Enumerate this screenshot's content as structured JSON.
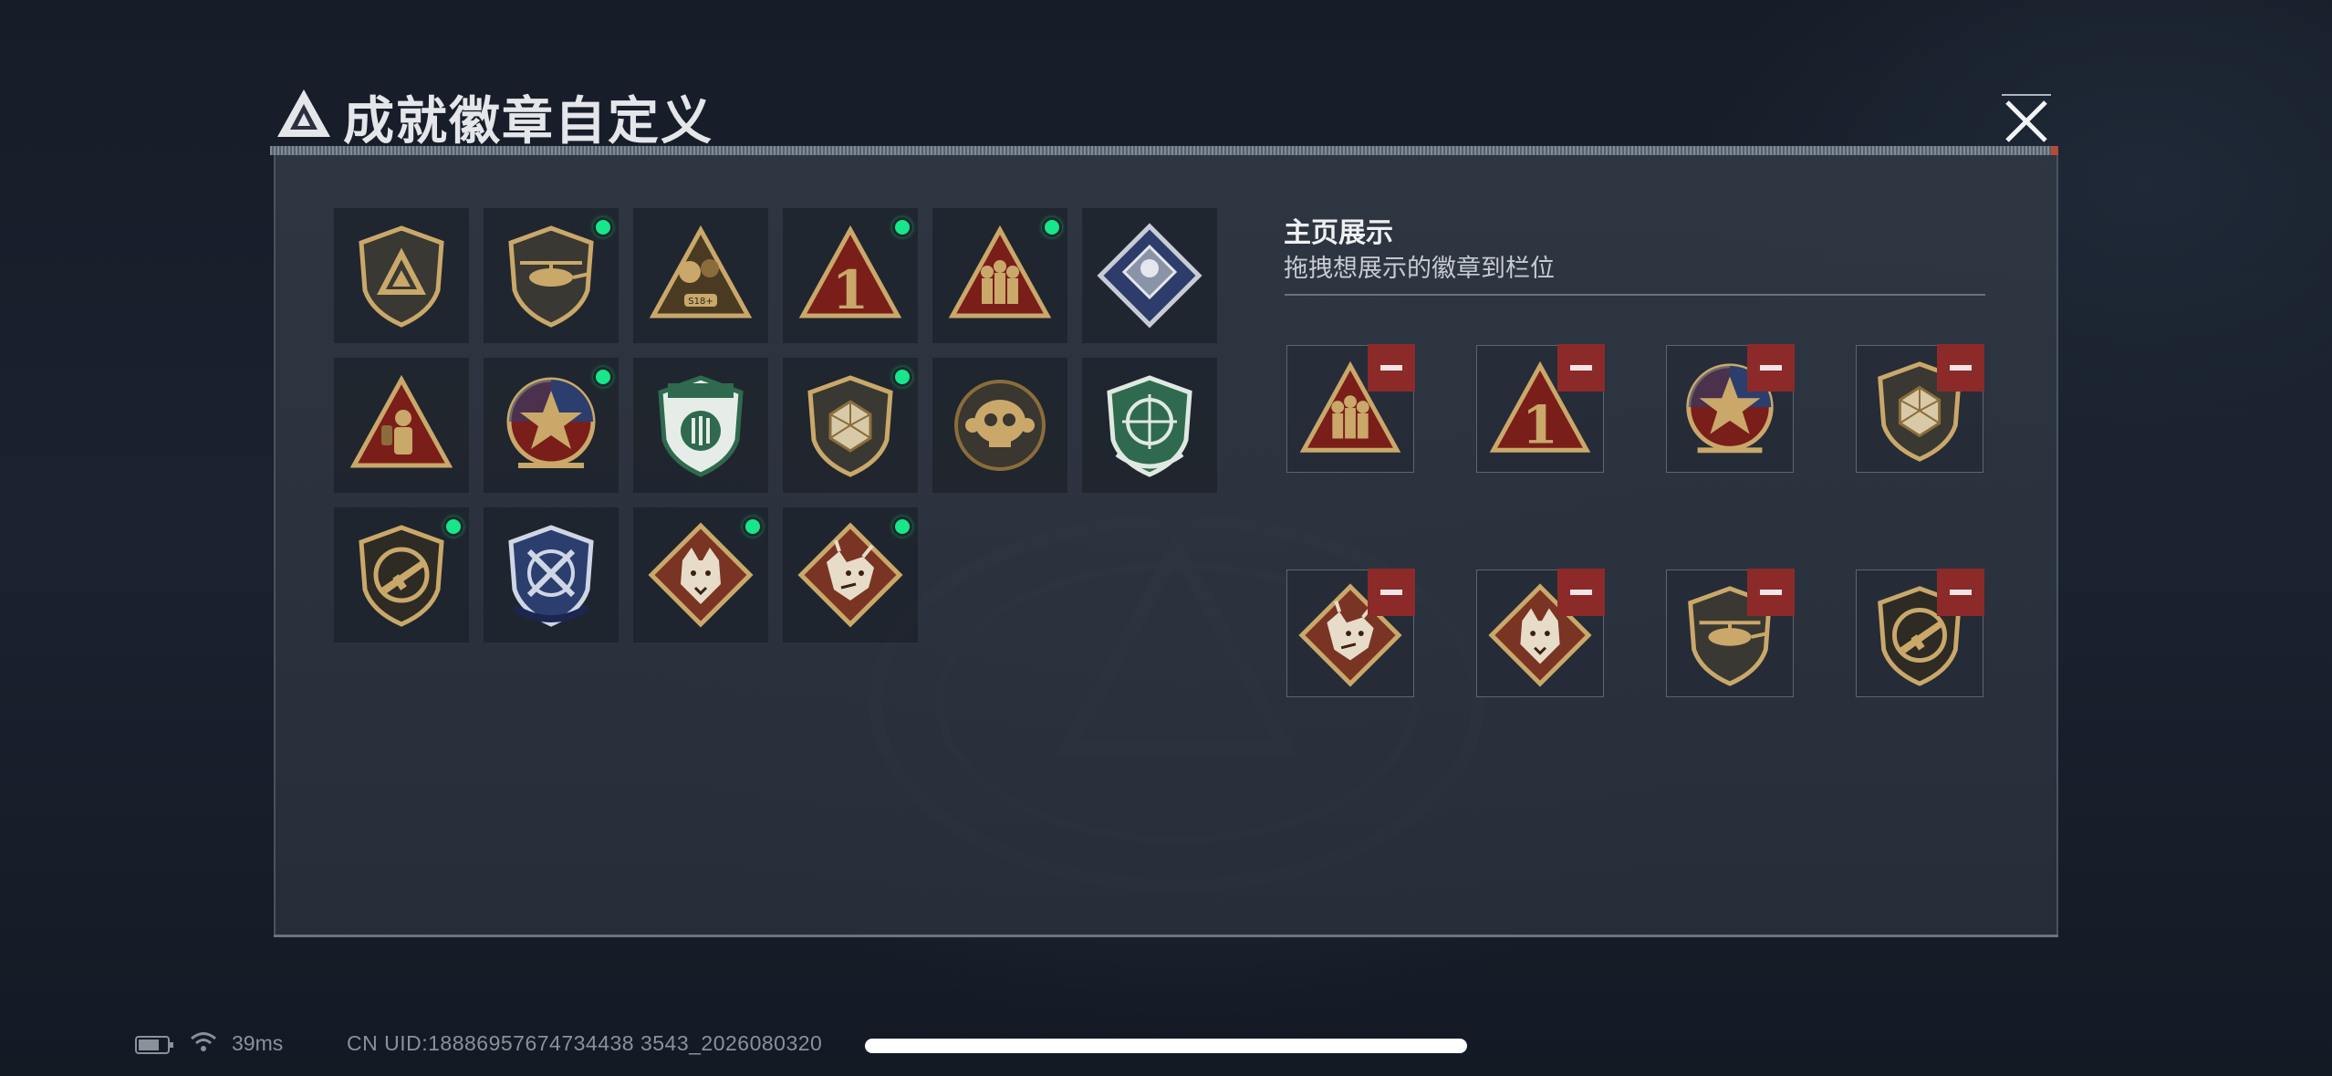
{
  "window": {
    "title": "成就徽章自定义",
    "close_icon": "close-x-icon"
  },
  "colors": {
    "new_indicator": "#17e68b",
    "remove_button": "#8c2a2a",
    "badge_gold": "#c9a86a",
    "badge_red": "#7a1e1a",
    "badge_green": "#2f6a4e",
    "badge_blue": "#2c3e6e"
  },
  "badge_collection": [
    {
      "icon": "triangle-logo-shield-badge",
      "new": false
    },
    {
      "icon": "helicopter-shield-badge",
      "new": true
    },
    {
      "icon": "s18-gold-triangle-badge",
      "new": false
    },
    {
      "icon": "number-1-red-triangle-badge",
      "new": true
    },
    {
      "icon": "soldiers-triangle-badge",
      "new": true
    },
    {
      "icon": "silver-diamond-badge",
      "new": false
    },
    {
      "icon": "operator-triangle-badge",
      "new": false
    },
    {
      "icon": "star-medallion-badge",
      "new": true
    },
    {
      "icon": "green-wing-shield-badge",
      "new": false
    },
    {
      "icon": "d20-shield-badge",
      "new": true
    },
    {
      "icon": "skull-round-badge",
      "new": false
    },
    {
      "icon": "green-crosshair-shield-badge",
      "new": false
    },
    {
      "icon": "rifle-shield-badge",
      "new": true
    },
    {
      "icon": "blue-crossed-shield-badge",
      "new": false
    },
    {
      "icon": "wolf-diamond-badge",
      "new": true
    },
    {
      "icon": "dragon-diamond-badge",
      "new": true
    }
  ],
  "showcase": {
    "title": "主页展示",
    "subtitle": "拖拽想展示的徽章到栏位",
    "slots": [
      {
        "icon": "soldiers-triangle-badge"
      },
      {
        "icon": "number-1-red-triangle-badge"
      },
      {
        "icon": "star-medallion-badge"
      },
      {
        "icon": "d20-shield-badge"
      },
      {
        "icon": "dragon-diamond-badge"
      },
      {
        "icon": "wolf-diamond-badge"
      },
      {
        "icon": "helicopter-shield-badge"
      },
      {
        "icon": "rifle-shield-badge"
      }
    ],
    "remove_icon": "minus-icon"
  },
  "status_bar": {
    "battery_icon": "battery-icon",
    "wifi_icon": "wifi-icon",
    "ping": "39ms",
    "uid": "CN UID:18886957674734438 3543_2026080320"
  }
}
